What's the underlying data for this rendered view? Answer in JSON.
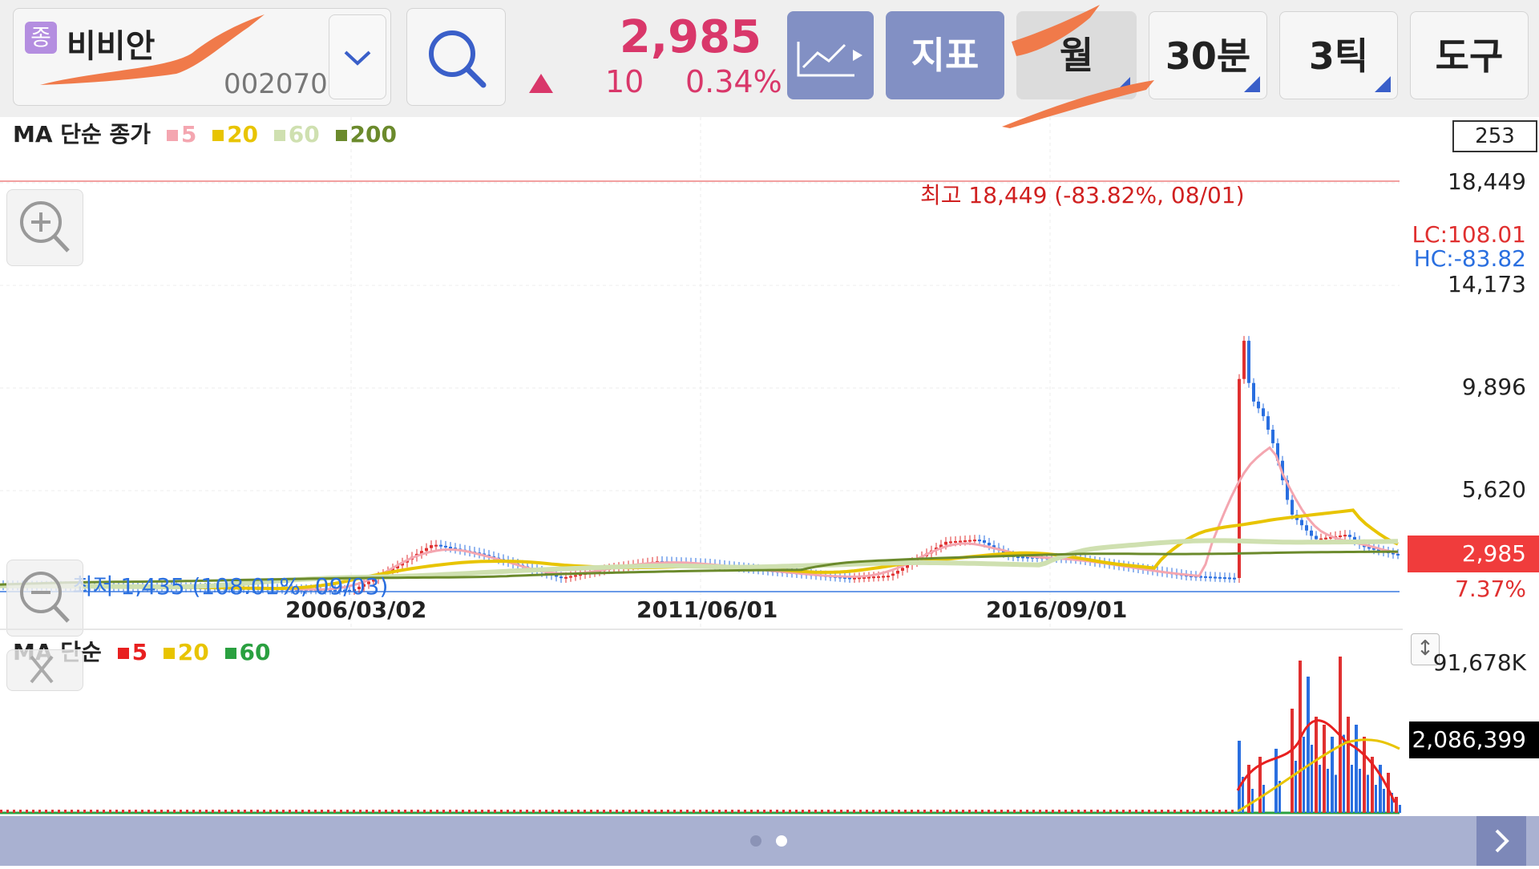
{
  "header": {
    "badge": "종",
    "stock_name": "비비안",
    "stock_code": "002070",
    "price": "2,985",
    "change": "10",
    "change_pct": "0.34%",
    "indicator_label": "지표",
    "period_month": "월",
    "period_30min": "30분",
    "period_3tick": "3틱",
    "tools_label": "도구"
  },
  "price_chart": {
    "legend_title": "MA 단순 종가",
    "ma_periods": [
      "5",
      "20",
      "60",
      "200"
    ],
    "ma_colors": [
      "#f4a6b0",
      "#e8c400",
      "#cfe0b0",
      "#6b8a2c"
    ],
    "visible_count": "253",
    "y_ticks": [
      "18,449",
      "14,173",
      "9,896",
      "5,620"
    ],
    "lc_label": "LC:108.01",
    "hc_label": "HC:-83.82",
    "current_price": "2,985",
    "current_pct": "7.37%",
    "high_label": "최고 18,449 (-83.82%, 08/01)",
    "low_label": "최저 1,435 (108.01%, 09/03)",
    "date_labels": [
      "2006/03/02",
      "2011/06/01",
      "2016/09/01"
    ],
    "up_color": "#e03030",
    "down_color": "#2a6fe0"
  },
  "volume_chart": {
    "legend_title": "MA 단순",
    "ma_periods": [
      "5",
      "20",
      "60"
    ],
    "ma_colors": [
      "#e82020",
      "#e8c400",
      "#2aa040"
    ],
    "max_label": "91,678K",
    "current_volume": "2,086,399"
  },
  "icons": {
    "dropdown": "chevron-down-icon",
    "search": "search-icon",
    "chart_type": "line-chart-icon",
    "zoom_in": "zoom-in-icon",
    "zoom_out": "zoom-out-icon",
    "close": "close-icon",
    "resize": "resize-icon",
    "next": "chevron-right-icon"
  }
}
